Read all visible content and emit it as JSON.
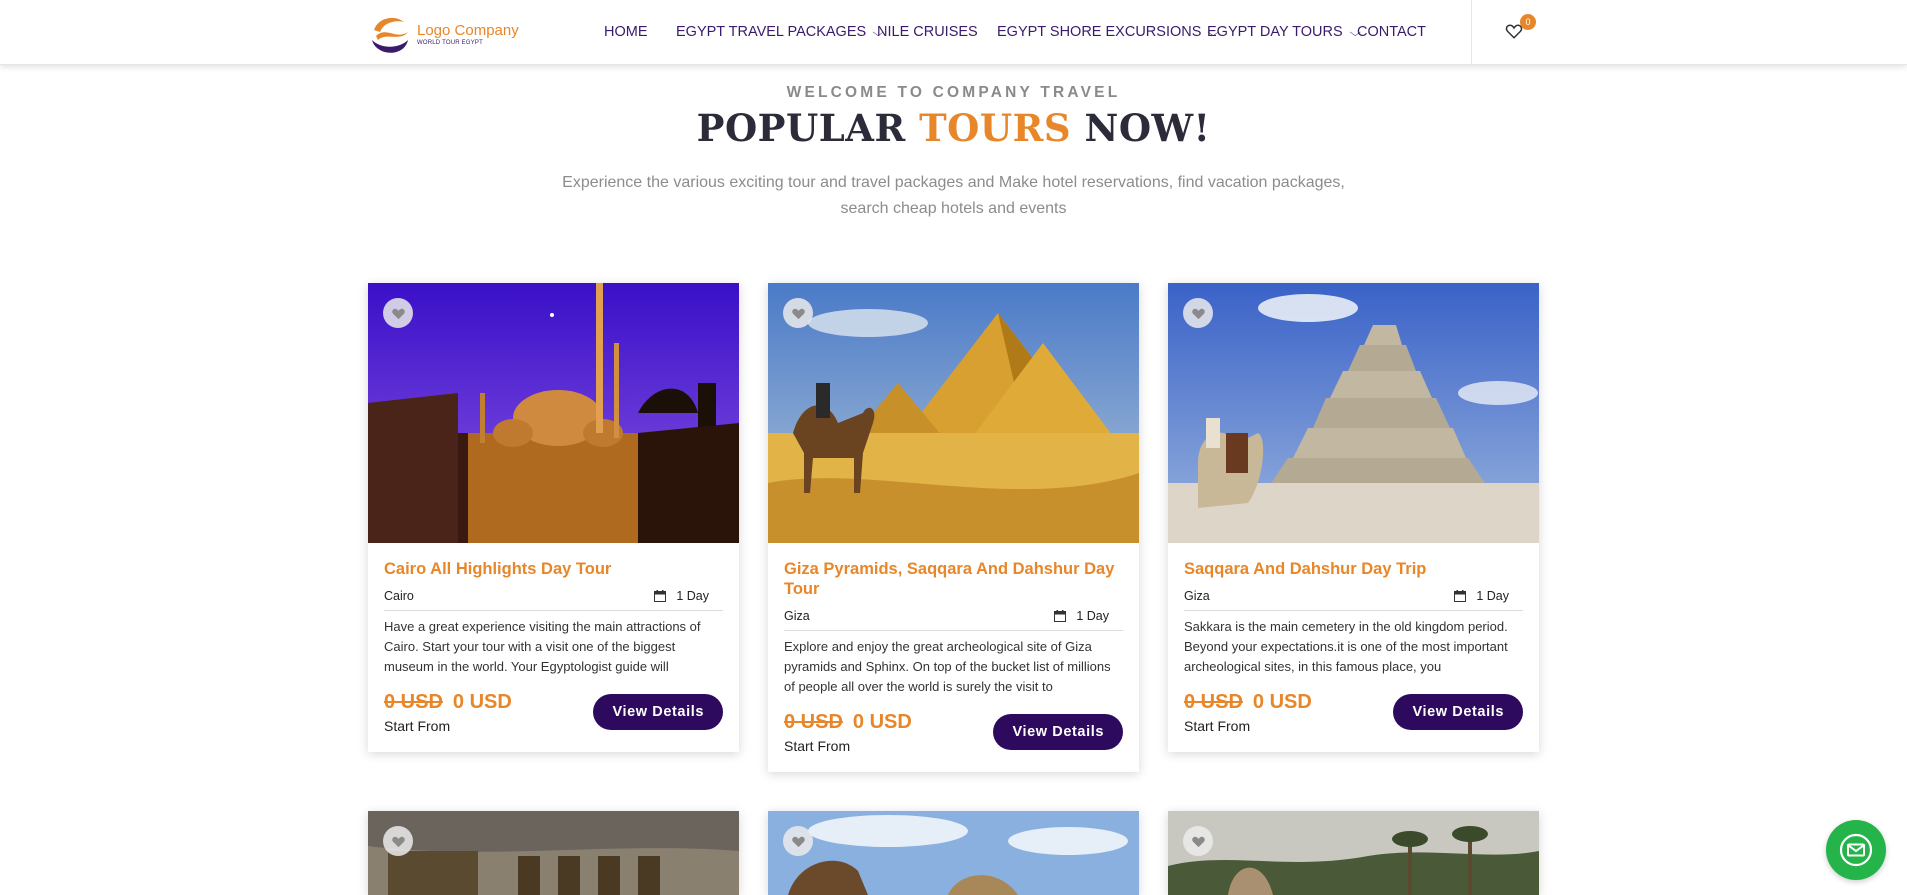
{
  "header": {
    "logo_name": "Logo Company",
    "logo_sub": "WORLD TOUR EGYPT",
    "nav": [
      {
        "label": "HOME",
        "dropdown": false
      },
      {
        "label": "EGYPT TRAVEL PACKAGES",
        "dropdown": true
      },
      {
        "label": "NILE CRUISES",
        "dropdown": false
      },
      {
        "label": "EGYPT SHORE EXCURSIONS",
        "dropdown": true
      },
      {
        "label": "EGYPT DAY TOURS",
        "dropdown": true
      },
      {
        "label": "CONTACT",
        "dropdown": false
      }
    ],
    "wishlist_count": "0"
  },
  "hero": {
    "eyebrow": "WELCOME TO COMPANY TRAVEL",
    "title_a": "POPULAR ",
    "title_accent": "TOURS",
    "title_b": " NOW!",
    "lede": "Experience the various exciting tour and travel packages and Make hotel reservations, find vacation packages, search cheap hotels and events"
  },
  "tours": [
    {
      "title": "Cairo All Highlights Day Tour",
      "location": "Cairo",
      "duration": "1 Day",
      "description": "Have a great experience visiting the main attractions of Cairo. Start your tour with a visit one of the biggest museum in the world. Your Egyptologist guide will",
      "old_price": "0 USD",
      "price": "0 USD",
      "price_note": "Start From",
      "cta": "View Details",
      "image": "mosque-at-night"
    },
    {
      "title": "Giza Pyramids, Saqqara And Dahshur Day Tour",
      "location": "Giza",
      "duration": "1 Day",
      "description": "Explore and enjoy the great archeological site of Giza pyramids and Sphinx. On top of the bucket list of millions of people all over the world is surely the visit to",
      "old_price": "0 USD",
      "price": "0 USD",
      "price_note": "Start From",
      "cta": "View Details",
      "image": "giza-pyramids-camel"
    },
    {
      "title": "Saqqara And Dahshur Day Trip",
      "location": "Giza",
      "duration": "1 Day",
      "description": "Sakkara is the main cemetery in the old kingdom period. Beyond your expectations.it is one of the most important archeological sites, in this famous place, you",
      "old_price": "0 USD",
      "price": "0 USD",
      "price_note": "Start From",
      "cta": "View Details",
      "image": "step-pyramid-camel"
    }
  ],
  "lower_row_images": [
    "temple-columns",
    "sphinx-camel",
    "palm-trees-statue"
  ],
  "colors": {
    "accent": "#e8862a",
    "brand": "#2d0a5e",
    "fab": "#25b44a"
  },
  "icons": {
    "wishlist": "heart-icon",
    "calendar": "calendar-icon",
    "contact": "envelope-icon"
  }
}
